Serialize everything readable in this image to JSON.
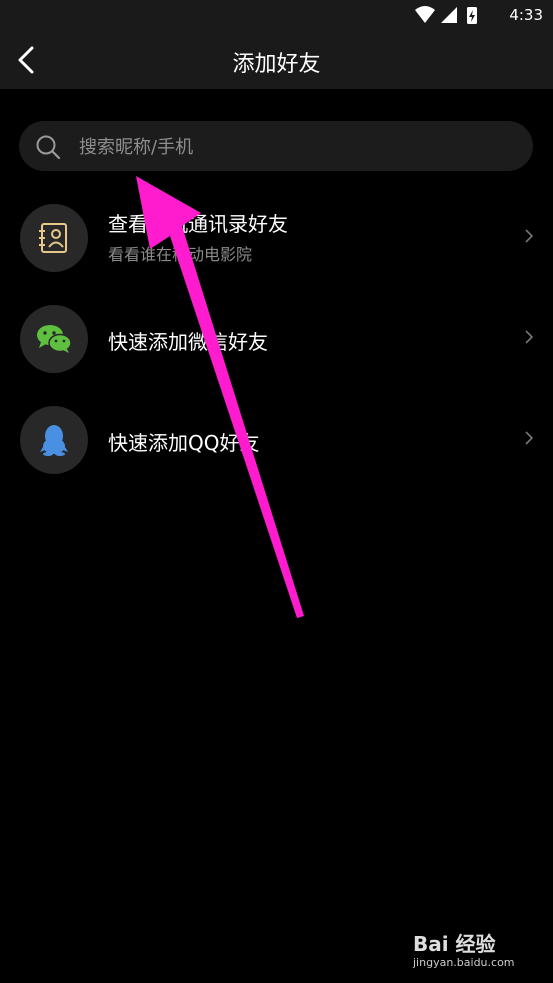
{
  "status_bar": {
    "time": "4:33",
    "icons": [
      "wifi-icon",
      "signal-icon",
      "battery-charging-icon"
    ]
  },
  "header": {
    "title": "添加好友",
    "back_icon": "back-arrow-icon"
  },
  "search": {
    "placeholder": "搜索昵称/手机",
    "value": ""
  },
  "list": [
    {
      "icon": "contacts-icon",
      "title": "查看手机通讯录好友",
      "subtitle": "看看谁在移动电影院",
      "icon_color": "#e6c98a"
    },
    {
      "icon": "wechat-icon",
      "title": "快速添加微信好友",
      "icon_color": "#5fbf3f"
    },
    {
      "icon": "qq-icon",
      "title": "快速添加QQ好友",
      "icon_color": "#4a90e2"
    }
  ],
  "watermark": {
    "logo": "Bai 经验",
    "url": "jingyan.baidu.com"
  },
  "colors": {
    "background": "#000000",
    "bar": "#1a1a1a",
    "search_bg": "#1c1c1c",
    "annotation_arrow": "#ff1ccf"
  }
}
